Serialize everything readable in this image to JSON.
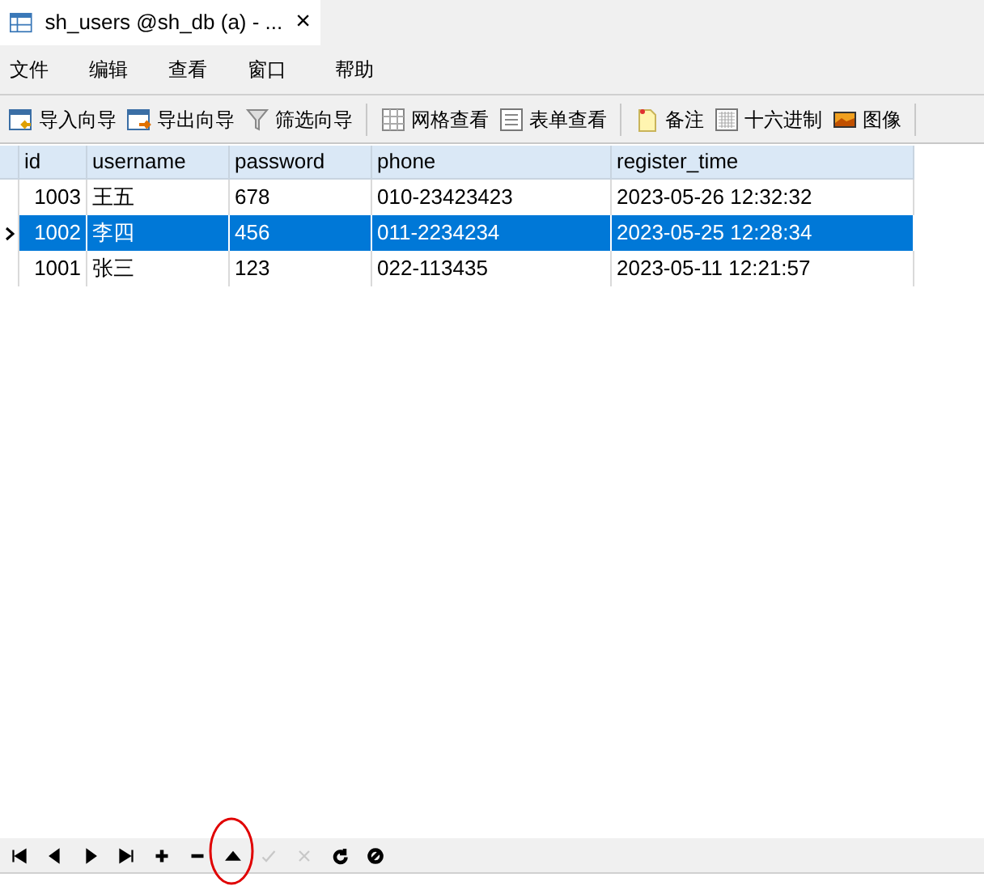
{
  "tab": {
    "title": "sh_users @sh_db (a) - ...",
    "close": "×"
  },
  "menu": [
    "文件",
    "编辑",
    "查看",
    "窗口",
    "帮助"
  ],
  "toolbar": [
    {
      "kind": "import",
      "label": "导入向导"
    },
    {
      "kind": "export",
      "label": "导出向导"
    },
    {
      "kind": "filter",
      "label": "筛选向导"
    },
    {
      "kind": "grid",
      "label": "网格查看"
    },
    {
      "kind": "form",
      "label": "表单查看"
    },
    {
      "kind": "memo",
      "label": "备注"
    },
    {
      "kind": "hex",
      "label": "十六进制"
    },
    {
      "kind": "image",
      "label": "图像"
    }
  ],
  "table": {
    "columns": [
      "id",
      "username",
      "password",
      "phone",
      "register_time"
    ],
    "rows": [
      {
        "selected": false,
        "cells": [
          "1003",
          "王五",
          "678",
          "010-23423423",
          "2023-05-26 12:32:32"
        ]
      },
      {
        "selected": true,
        "cells": [
          "1002",
          "李四",
          "456",
          "011-2234234",
          "2023-05-25 12:28:34"
        ]
      },
      {
        "selected": false,
        "cells": [
          "1001",
          "张三",
          "123",
          "022-113435",
          "2023-05-11 12:21:57"
        ]
      }
    ]
  },
  "nav": [
    {
      "kind": "first",
      "disabled": false
    },
    {
      "kind": "prev",
      "disabled": false
    },
    {
      "kind": "next",
      "disabled": false
    },
    {
      "kind": "last",
      "disabled": false
    },
    {
      "kind": "add",
      "disabled": false
    },
    {
      "kind": "delete",
      "disabled": false
    },
    {
      "kind": "up",
      "disabled": false
    },
    {
      "kind": "apply",
      "disabled": true
    },
    {
      "kind": "discard",
      "disabled": true
    },
    {
      "kind": "refresh",
      "disabled": false
    },
    {
      "kind": "stop",
      "disabled": false
    }
  ]
}
